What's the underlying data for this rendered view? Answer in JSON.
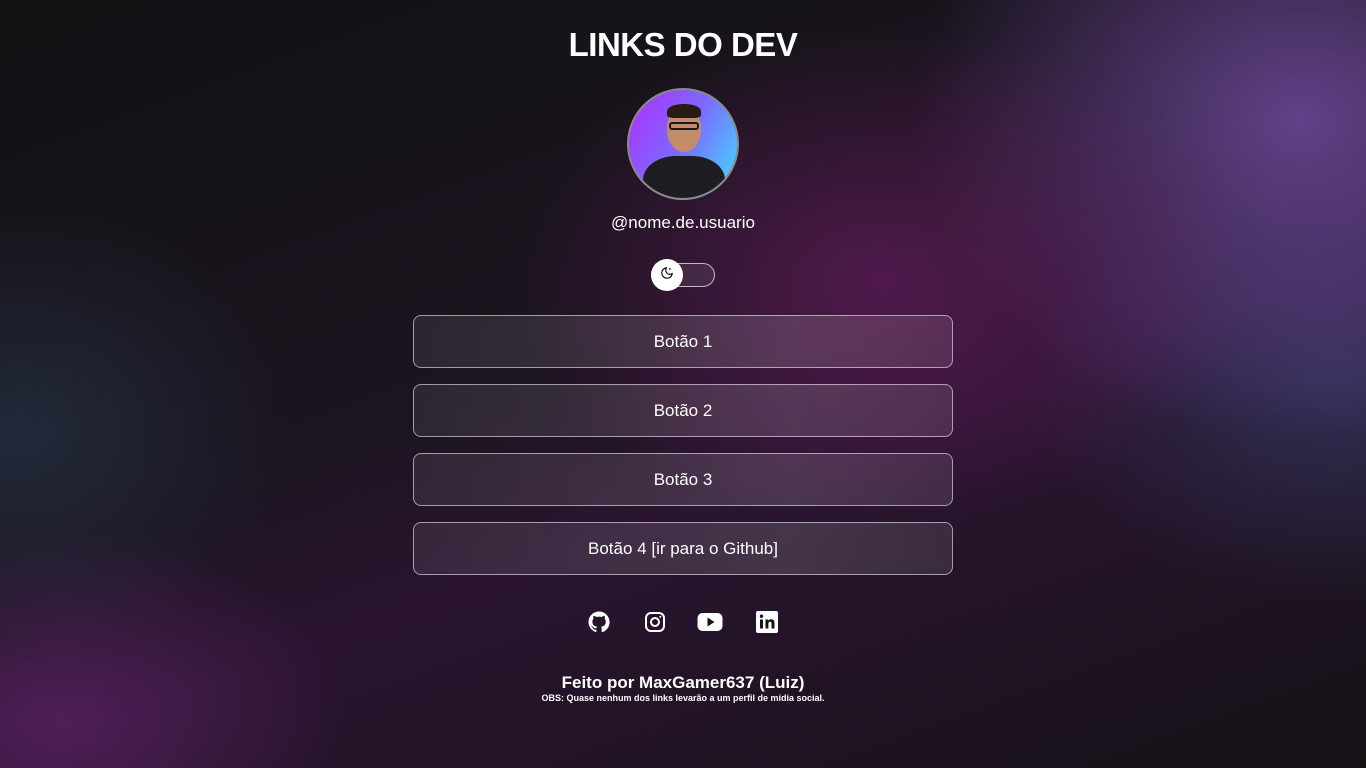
{
  "page": {
    "title": "LINKS DO DEV",
    "username": "@nome.de.usuario"
  },
  "theme_toggle": {
    "state": "dark",
    "icon": "moon-icon"
  },
  "buttons": [
    {
      "label": "Botão 1"
    },
    {
      "label": "Botão 2"
    },
    {
      "label": "Botão 3"
    },
    {
      "label": "Botão 4 [ir para o Github]"
    }
  ],
  "socials": [
    {
      "icon": "github-icon"
    },
    {
      "icon": "instagram-icon"
    },
    {
      "icon": "youtube-icon"
    },
    {
      "icon": "linkedin-icon"
    }
  ],
  "footer": {
    "credit": "Feito por MaxGamer637 (Luiz)",
    "note": "OBS: Quase nenhum dos links levarão a um perfil de mídia social."
  },
  "colors": {
    "background": "#121214",
    "accent_purple": "#7a3aa0",
    "text": "#ffffff"
  }
}
